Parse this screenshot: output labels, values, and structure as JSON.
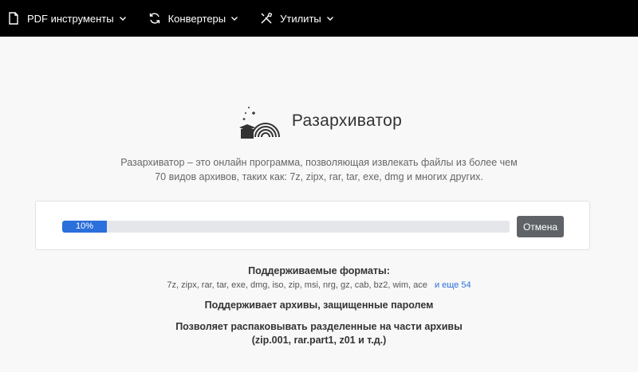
{
  "nav": {
    "items": [
      {
        "label": "PDF инструменты",
        "icon": "document-icon"
      },
      {
        "label": "Конвертеры",
        "icon": "refresh-icon"
      },
      {
        "label": "Утилиты",
        "icon": "tools-icon"
      }
    ]
  },
  "hero": {
    "title": "Разархиватор",
    "logo_icon": "rainbow-box-icon"
  },
  "description": {
    "line1": "Разархиватор – это онлайн программа, позволяющая извлекать файлы из более чем",
    "line2": "70 видов архивов, таких как: 7z, zipx, rar, tar, exe, dmg и многих других."
  },
  "progress": {
    "percent": 10,
    "label": "10%",
    "cancel_label": "Отмена"
  },
  "formats": {
    "title": "Поддерживаемые форматы:",
    "list": "7z, zipx, rar, tar, exe, dmg, iso, zip, msi, nrg, gz, cab, bz2, wim, ace",
    "more_link": "и еще 54"
  },
  "features": {
    "password": "Поддерживает архивы, защищенные паролем",
    "split_line1": "Позволяет распаковывать разделенные на части архивы",
    "split_line2": "(zip.001, rar.part1, z01 и т.д.)"
  },
  "colors": {
    "nav_bg": "#000000",
    "progress_fill": "#2a6fdb",
    "cancel_bg": "#5f6368",
    "link": "#2a6fdb"
  }
}
